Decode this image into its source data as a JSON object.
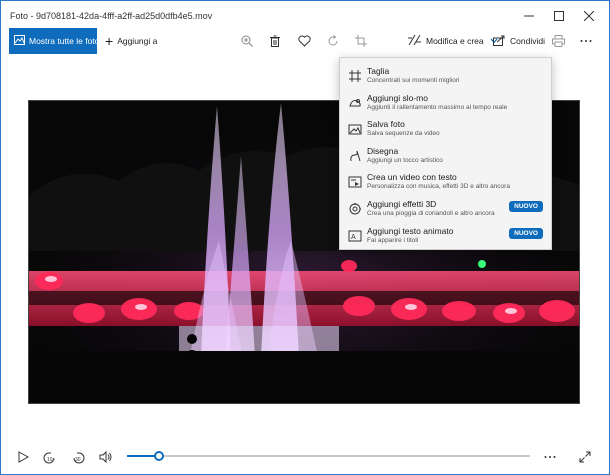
{
  "window": {
    "title": "Foto - 9d708181-42da-4fff-a2ff-ad25d0dfb4e5.mov",
    "controls": [
      "minimize-icon",
      "maximize-icon",
      "close-icon"
    ]
  },
  "toolbar": {
    "all_photos_label": "Mostra tutte le foto",
    "add_to_label": "Aggiungi a",
    "edit_create_label": "Modifica e crea",
    "share_label": "Condividi",
    "icons": [
      "zoom-icon",
      "delete-icon",
      "favorite-icon",
      "rotate-icon",
      "crop-icon",
      "print-icon",
      "more-icon"
    ]
  },
  "menu": {
    "items": [
      {
        "title": "Taglia",
        "subtitle": "Concentrati sui momenti migliori",
        "icon": "trim-icon",
        "badge": ""
      },
      {
        "title": "Aggiungi slo-mo",
        "subtitle": "Aggiunti il rallentamento massimo al tempo reale",
        "icon": "slomo-icon",
        "badge": ""
      },
      {
        "title": "Salva foto",
        "subtitle": "Salva sequenze da video",
        "icon": "save-photo-icon",
        "badge": ""
      },
      {
        "title": "Disegna",
        "subtitle": "Aggiungi un tocco artistico",
        "icon": "draw-icon",
        "badge": ""
      },
      {
        "title": "Crea un video con testo",
        "subtitle": "Personalizza con musica, effetti 3D e altro ancora",
        "icon": "video-text-icon",
        "badge": ""
      },
      {
        "title": "Aggiungi effetti 3D",
        "subtitle": "Crea una pioggia di coriandoli e altro ancora",
        "icon": "effects-3d-icon",
        "badge": "NUOVO"
      },
      {
        "title": "Aggiungi testo animato",
        "subtitle": "Fai apparire i titoli",
        "icon": "animated-text-icon",
        "badge": "NUOVO"
      }
    ]
  },
  "player": {
    "progress": 0.08,
    "icons": [
      "play-icon",
      "rewind-10-icon",
      "forward-30-icon",
      "volume-icon",
      "more-icon",
      "fullscreen-icon"
    ]
  },
  "colors": {
    "accent": "#0f6cbd",
    "fountain_light": "#e4b8ff",
    "fountain_red": "#ff2a5a"
  }
}
